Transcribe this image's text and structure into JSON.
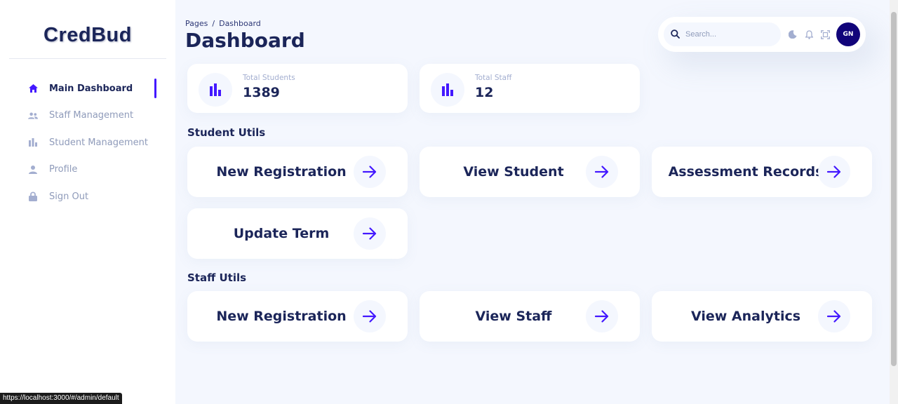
{
  "sidebar": {
    "brand": "CredBud",
    "items": [
      {
        "label": "Main Dashboard",
        "icon": "home-icon",
        "active": true
      },
      {
        "label": "Staff Management",
        "icon": "people-icon"
      },
      {
        "label": "Student Management",
        "icon": "bar-chart-icon"
      },
      {
        "label": "Profile",
        "icon": "person-icon"
      },
      {
        "label": "Sign Out",
        "icon": "lock-icon"
      }
    ]
  },
  "header": {
    "breadcrumb": {
      "root": "Pages",
      "separator": "/",
      "current": "Dashboard"
    },
    "title": "Dashboard",
    "search_placeholder": "Search...",
    "avatar_initials": "GN"
  },
  "stats": [
    {
      "label": "Total Students",
      "value": "1389"
    },
    {
      "label": "Total Staff",
      "value": "12"
    }
  ],
  "student_utils": {
    "title": "Student Utils",
    "actions": [
      "New Registration",
      "View Student",
      "Assessment Records",
      "Update Term"
    ]
  },
  "staff_utils": {
    "title": "Staff Utils",
    "actions": [
      "New Registration",
      "View Staff",
      "View Analytics"
    ]
  },
  "status_url": "https://localhost:3000/#/admin/default",
  "colors": {
    "brand": "#1b2559",
    "accent": "#4318ff",
    "avatar": "#11047a",
    "background": "#f4f7fe"
  }
}
